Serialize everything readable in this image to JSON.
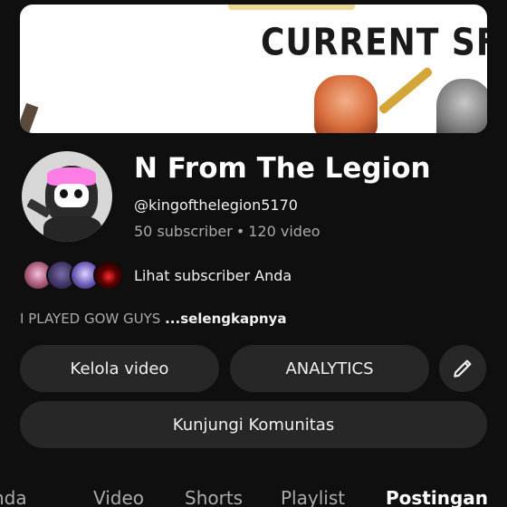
{
  "banner": {
    "text": "CURRENT SF"
  },
  "channel": {
    "name": "N From The Legion",
    "handle": "@kingofthelegion5170",
    "subscribers": "50 subscriber",
    "separator": "•",
    "videos": "120 video"
  },
  "subscribers_link": {
    "label": "Lihat subscriber Anda"
  },
  "description": {
    "text": "I PLAYED GOW GUYS",
    "more": "...selengkapnya"
  },
  "buttons": {
    "manage_videos": "Kelola video",
    "analytics": "ANALYTICS",
    "edit_icon": "pencil-icon",
    "visit_community": "Kunjungi Komunitas"
  },
  "tabs": [
    {
      "label": "nda",
      "active": false
    },
    {
      "label": "Video",
      "active": false
    },
    {
      "label": "Shorts",
      "active": false
    },
    {
      "label": "Playlist",
      "active": false
    },
    {
      "label": "Postingan",
      "active": true
    }
  ],
  "colors": {
    "background": "#0f0f0f",
    "button": "#272727",
    "text_primary": "#f1f1f1",
    "text_secondary": "#aaaaaa"
  }
}
